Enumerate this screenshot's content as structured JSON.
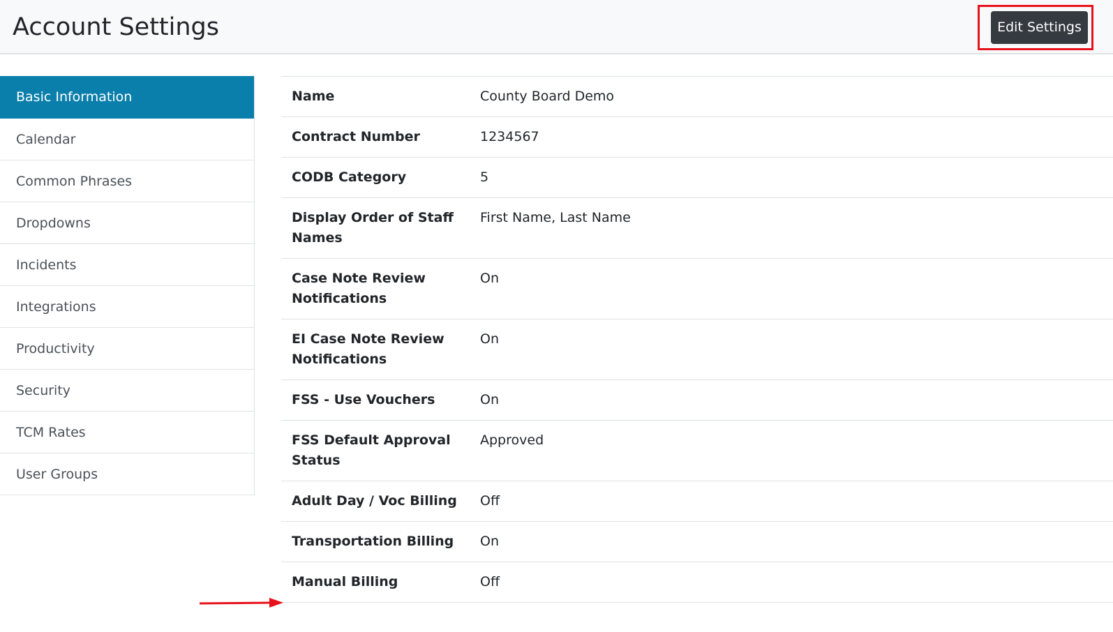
{
  "header": {
    "title": "Account Settings",
    "edit_button_label": "Edit Settings",
    "highlight_color": "#e6111b"
  },
  "sidebar": {
    "items": [
      {
        "label": "Basic Information",
        "active": true
      },
      {
        "label": "Calendar"
      },
      {
        "label": "Common Phrases"
      },
      {
        "label": "Dropdowns"
      },
      {
        "label": "Incidents"
      },
      {
        "label": "Integrations"
      },
      {
        "label": "Productivity"
      },
      {
        "label": "Security"
      },
      {
        "label": "TCM Rates"
      },
      {
        "label": "User Groups"
      }
    ],
    "active_color": "#0b7fab"
  },
  "settings": {
    "rows": [
      {
        "label": "Name",
        "value": "County Board Demo"
      },
      {
        "label": "Contract Number",
        "value": "1234567"
      },
      {
        "label": "CODB Category",
        "value": "5"
      },
      {
        "label": "Display Order of Staff Names",
        "value": "First Name, Last Name"
      },
      {
        "label": "Case Note Review Notifications",
        "value": "On"
      },
      {
        "label": "EI Case Note Review Notifications",
        "value": "On"
      },
      {
        "label": "FSS - Use Vouchers",
        "value": "On"
      },
      {
        "label": "FSS Default Approval Status",
        "value": "Approved"
      },
      {
        "label": "Adult Day / Voc Billing",
        "value": "Off"
      },
      {
        "label": "Transportation Billing",
        "value": "On"
      },
      {
        "label": "Manual Billing",
        "value": "Off"
      }
    ]
  },
  "annotation": {
    "arrow_icon": "red-arrow-right-icon",
    "arrow_color": "#e6111b"
  }
}
